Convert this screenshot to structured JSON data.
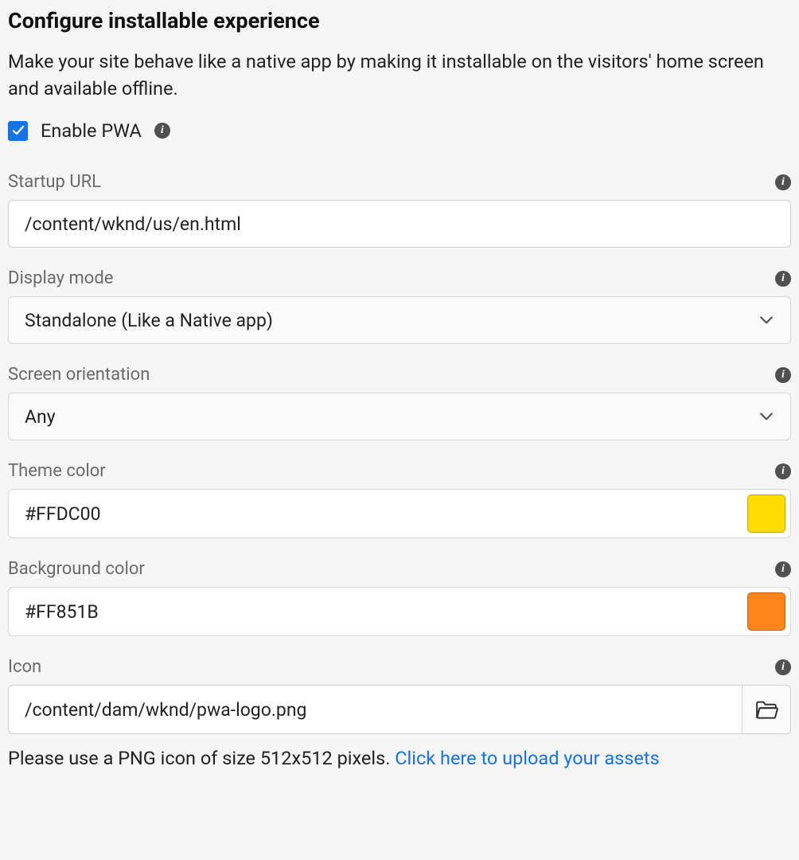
{
  "heading": "Configure installable experience",
  "description": "Make your site behave like a native app by making it installable on the visitors' home screen and available offline.",
  "enable": {
    "label": "Enable PWA",
    "checked": true
  },
  "fields": {
    "startup_url": {
      "label": "Startup URL",
      "value": "/content/wknd/us/en.html"
    },
    "display_mode": {
      "label": "Display mode",
      "value": "Standalone (Like a Native app)"
    },
    "screen_orientation": {
      "label": "Screen orientation",
      "value": "Any"
    },
    "theme_color": {
      "label": "Theme color",
      "value": "#FFDC00",
      "swatch": "#FFDC00"
    },
    "background_color": {
      "label": "Background color",
      "value": "#FF851B",
      "swatch": "#FF851B"
    },
    "icon": {
      "label": "Icon",
      "value": "/content/dam/wknd/pwa-logo.png"
    }
  },
  "hint": {
    "text": "Please use a PNG icon of size 512x512 pixels. ",
    "link": "Click here to upload your assets"
  }
}
